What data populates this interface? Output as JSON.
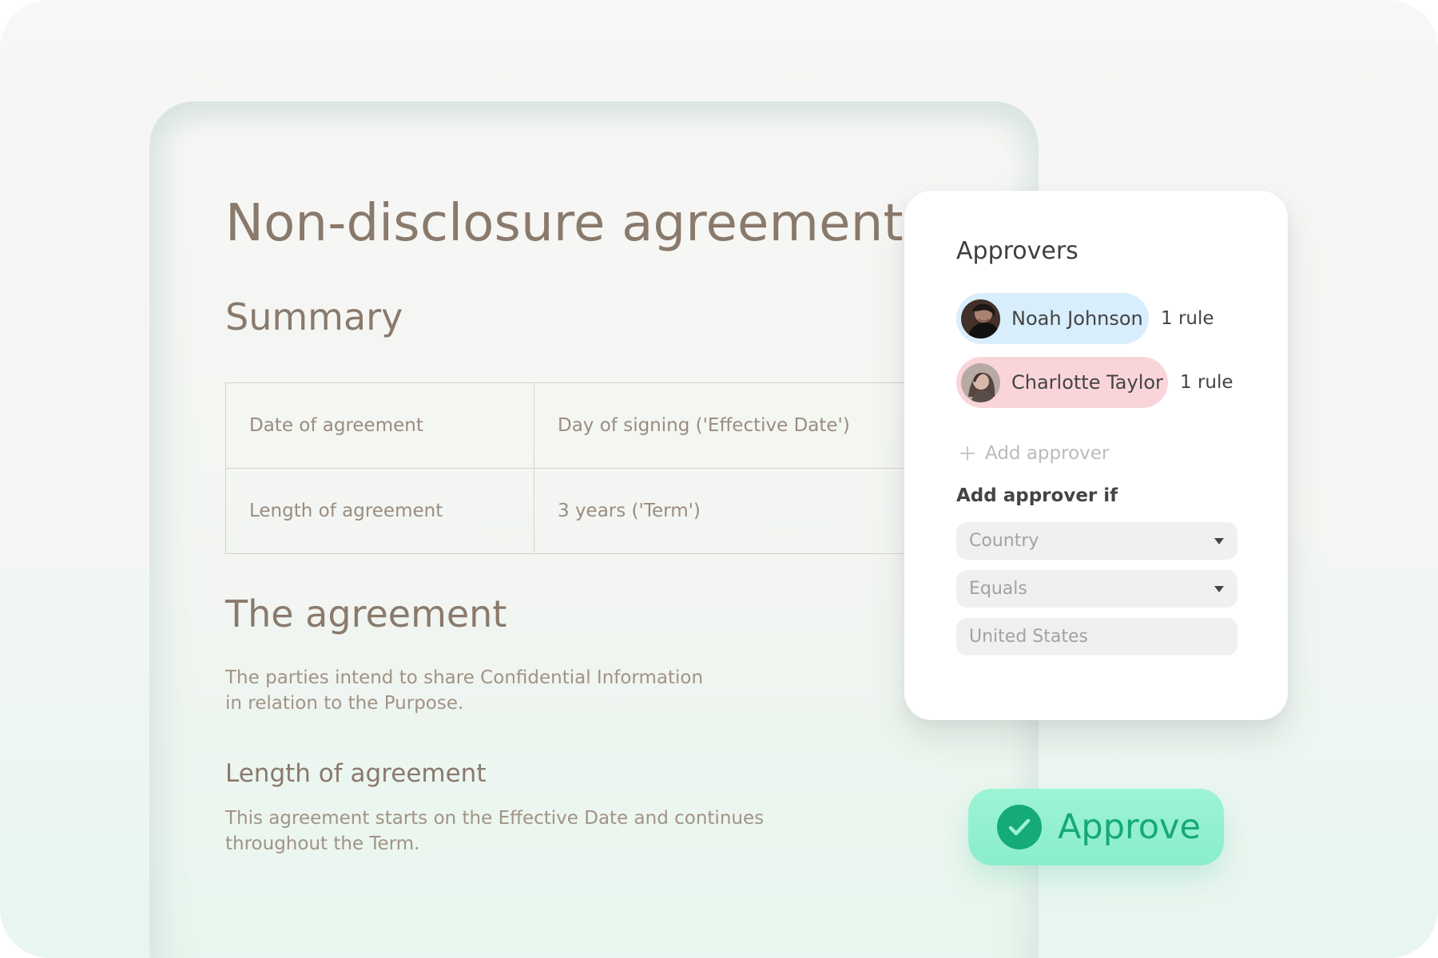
{
  "document": {
    "title": "Non-disclosure agreement",
    "summary_heading": "Summary",
    "summary_table": {
      "rows": [
        {
          "label": "Date of agreement",
          "value": "Day of signing ('Effective Date')"
        },
        {
          "label": "Length of agreement",
          "value": "3 years ('Term')"
        }
      ]
    },
    "agreement_heading": "The agreement",
    "agreement_text_lines": [
      "The parties intend to share Confidential Information",
      "in relation to the Purpose."
    ],
    "length_heading": "Length of agreement",
    "length_text_lines": [
      "This agreement starts on the Effective Date and continues",
      "throughout the Term."
    ]
  },
  "approvers_panel": {
    "title": "Approvers",
    "approvers": [
      {
        "name": "Noah Johnson",
        "rule_count": "1 rule",
        "pill_color": "#d8eefd"
      },
      {
        "name": "Charlotte Taylor",
        "rule_count": "1 rule",
        "pill_color": "#f9d5da"
      }
    ],
    "add_approver_label": "Add approver",
    "condition_label": "Add approver if",
    "condition_fields": [
      {
        "value": "Country",
        "kind": "dropdown"
      },
      {
        "value": "Equals",
        "kind": "dropdown"
      },
      {
        "value": "United States",
        "kind": "text"
      }
    ]
  },
  "approve_button": {
    "label": "Approve",
    "accent_color": "#17a977",
    "background_color": "#92f1d0"
  },
  "icons": {
    "add": "plus-icon",
    "dropdown": "chevron-down-icon",
    "approve": "check-circle-icon"
  }
}
